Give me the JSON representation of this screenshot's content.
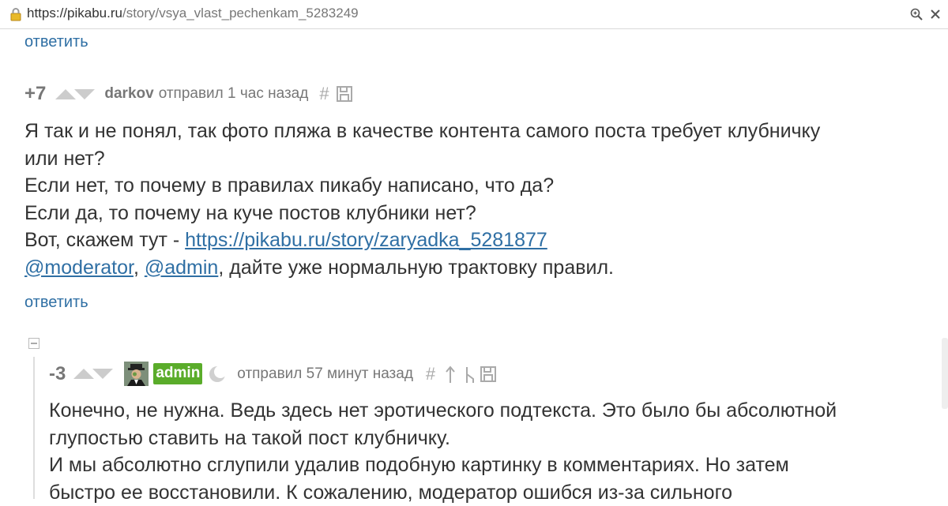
{
  "browser": {
    "url_host": "https://pikabu.ru",
    "url_path": "/story/vsya_vlast_pechenkam_5283249"
  },
  "top_reply": {
    "label": "ответить"
  },
  "comment1": {
    "score": "+7",
    "author": "darkov",
    "sent_text": "отправил 1 час назад",
    "lines": {
      "l1": "Я так и не понял, так фото пляжа в качестве контента самого поста требует клубничку",
      "l2": "или нет?",
      "l3": "Если нет, то почему в правилах пикабу написано, что да?",
      "l4": "Если да, то почему на куче постов клубники нет?",
      "l5_prefix": "Вот, скажем тут - ",
      "l5_link": "https://pikabu.ru/story/zaryadka_5281877",
      "l6_mention1": "@moderator",
      "l6_sep": ", ",
      "l6_mention2": "@admin",
      "l6_rest": ", дайте уже нормальную трактовку правил."
    },
    "reply_label": "ответить"
  },
  "comment2": {
    "score": "-3",
    "author": "admin",
    "sent_text": "отправил 57 минут назад",
    "lines": {
      "l1": "Конечно, не нужна. Ведь здесь нет эротического подтекста. Это было бы абсолютной",
      "l2": "глупостью ставить на такой пост клубничку.",
      "l3": "И мы абсолютно сглупили удалив подобную картинку в комментариях. Но затем",
      "l4": "быстро ее восстановили. К сожалению, модератор ошибся из-за сильного"
    }
  },
  "icons": {
    "lock": "lock-icon",
    "zoom": "zoom-icon",
    "close": "close-icon",
    "hash": "hash-icon",
    "save": "save-icon",
    "arrow_up": "arrow-up-icon",
    "branch": "branch-icon",
    "moon": "moon-icon",
    "collapse": "collapse-icon"
  },
  "colors": {
    "link": "#2f6fa4",
    "badge_green": "#5aac2a",
    "meta_gray": "#777777",
    "text": "#333333"
  }
}
